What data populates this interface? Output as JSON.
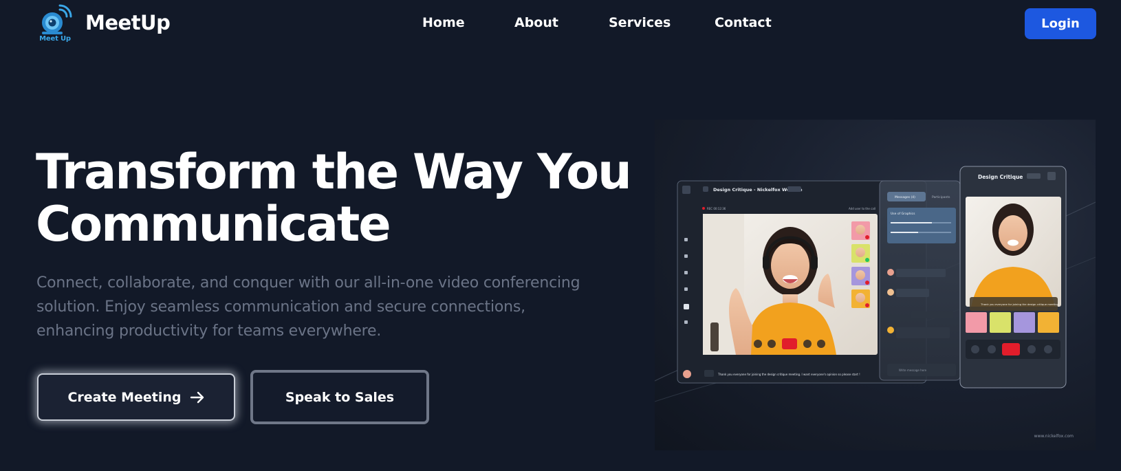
{
  "nav": {
    "logo_caption": "Meet Up",
    "brand": "MeetUp",
    "links": [
      "Home",
      "About",
      "Services",
      "Contact"
    ],
    "login_label": "Login"
  },
  "hero": {
    "title_line1": "Transform the Way You",
    "title_line2": "Communicate",
    "subtitle": "Connect, collaborate, and conquer with our all-in-one video conferencing solution. Enjoy seamless communication and secure connections, enhancing productivity for teams everywhere.",
    "create_meeting_label": "Create Meeting",
    "speak_to_sales_label": "Speak to Sales"
  },
  "illustration": {
    "desktop_title": "Design Critique - Nickelfox Website",
    "desktop_rec": "REC 00:12:36",
    "desktop_add_user": "Add user to the call",
    "tab_messages": "Messages (4)",
    "tab_participants": "Participants",
    "poll_title": "Use of Graphics",
    "chat_caption": "Thank you everyone for joining the design critique meeting. I want everyone's opinion so please start !",
    "write_message_placeholder": "Write message here",
    "mobile_title": "Design Critique",
    "watermark": "www.nickelfox.com"
  },
  "colors": {
    "background": "#121928",
    "primary": "#1d58e0",
    "logo_blue": "#3aa7e8",
    "muted_text": "#6b7487",
    "end_call": "#e11d2b"
  }
}
